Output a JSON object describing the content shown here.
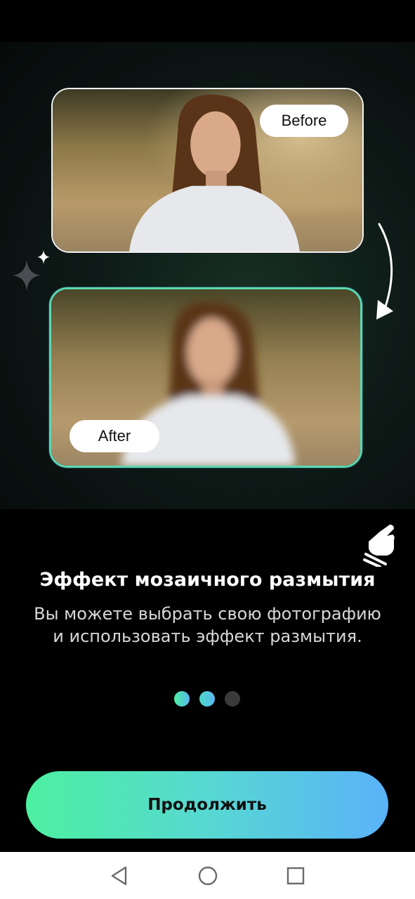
{
  "photos": {
    "before_label": "Before",
    "after_label": "After"
  },
  "onboarding": {
    "title": "Эффект мозаичного размытия",
    "description": "Вы можете выбрать свою фотографию и использовать эффект размытия.",
    "current_page": 2,
    "total_pages": 3
  },
  "actions": {
    "continue_label": "Продолжить"
  },
  "icons": {
    "arrow": "curved-arrow-icon",
    "sparkle": "sparkle-icon",
    "hand": "tap-hand-icon",
    "nav_back": "back-triangle-icon",
    "nav_home": "home-circle-icon",
    "nav_recents": "recents-square-icon"
  },
  "colors": {
    "accent_start": "#4cf0a0",
    "accent_end": "#5ab2f8",
    "inactive_dot": "#3a3a3a",
    "background": "#000000"
  }
}
